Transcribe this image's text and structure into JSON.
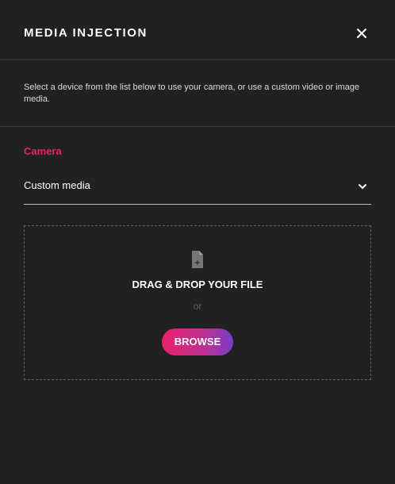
{
  "dialog": {
    "title": "MEDIA INJECTION",
    "close_icon": "close-icon"
  },
  "description": "Select a device from the list below to use your camera, or use a custom video or image media.",
  "camera": {
    "label": "Camera",
    "selected": "Custom media",
    "chevron_icon": "chevron-down-icon"
  },
  "dropzone": {
    "icon": "file-add-icon",
    "title": "DRAG & DROP YOUR FILE",
    "or_text": "or",
    "browse_label": "BROWSE"
  },
  "colors": {
    "background": "#212121",
    "accent": "#e8216b",
    "gradient_end": "#7a3cc8",
    "divider": "#3a3a3a"
  }
}
